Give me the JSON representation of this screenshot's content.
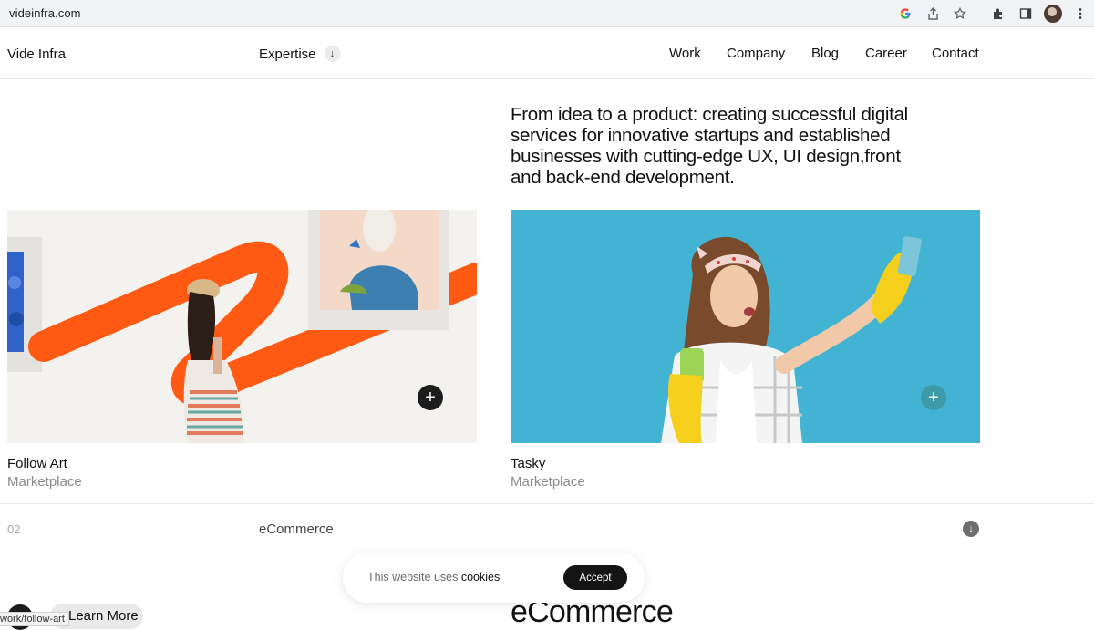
{
  "browser": {
    "url": "videinfra.com",
    "icons": [
      "google-icon",
      "share-icon",
      "star-icon",
      "extensions-icon",
      "sidepanel-icon",
      "profile-avatar",
      "menu-icon"
    ]
  },
  "nav": {
    "brand": "Vide Infra",
    "expertise": "Expertise",
    "links": [
      "Work",
      "Company",
      "Blog",
      "Career",
      "Contact"
    ]
  },
  "hero": {
    "text": "From idea to a product: creating successful digital services for innovative startups and established businesses with cutting-edge UX, UI design,front and back-end development."
  },
  "cards": [
    {
      "title": "Follow Art",
      "category": "Marketplace"
    },
    {
      "title": "Tasky",
      "category": "Marketplace"
    }
  ],
  "section_row": {
    "number": "02",
    "label": "eCommerce"
  },
  "cookie": {
    "text": "This website uses ",
    "link": "cookies",
    "accept": "Accept"
  },
  "bottom": {
    "heading": "eCommerce",
    "learn_more": "Learn More",
    "status_url": "work/follow-art"
  },
  "colors": {
    "accent_orange": "#ff5a14",
    "teal": "#42b3d3",
    "dark": "#1c1c1c"
  }
}
